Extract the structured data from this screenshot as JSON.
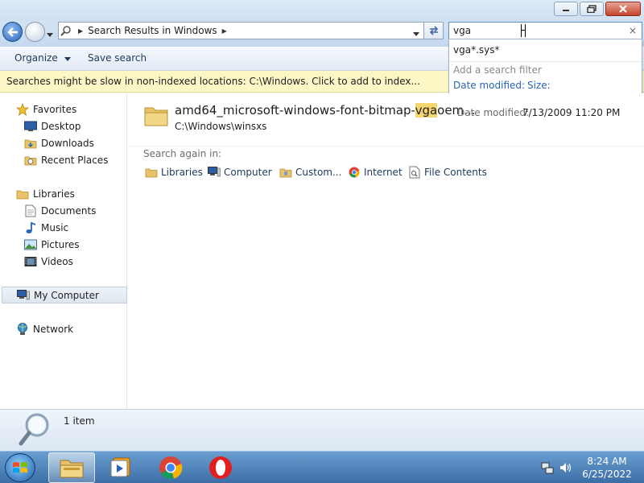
{
  "address": {
    "location": "Search Results in Windows"
  },
  "search": {
    "value": "vga",
    "clear_glyph": "×"
  },
  "suggestions": {
    "items": [
      "vga*.sys*"
    ],
    "filter_title": "Add a search filter",
    "filters": [
      "Date modified:",
      "Size:"
    ]
  },
  "toolbar": {
    "organize": "Organize",
    "save_search": "Save search"
  },
  "infobar": {
    "text": "Searches might be slow in non-indexed locations: C:\\Windows. Click to add to index..."
  },
  "sidebar": {
    "favorites": {
      "label": "Favorites",
      "items": [
        "Desktop",
        "Downloads",
        "Recent Places"
      ]
    },
    "libraries": {
      "label": "Libraries",
      "items": [
        "Documents",
        "Music",
        "Pictures",
        "Videos"
      ]
    },
    "computer": "My Computer",
    "network": "Network"
  },
  "results": [
    {
      "name_before": "amd64_microsoft-windows-font-bitmap-",
      "name_highlight": "vga",
      "name_after": "oem...",
      "path": "C:\\Windows\\winsxs",
      "date_label": "Date modified:",
      "date": "7/13/2009 11:20 PM"
    }
  ],
  "search_again": {
    "label": "Search again in:",
    "items": [
      "Libraries",
      "Computer",
      "Custom...",
      "Internet",
      "File Contents"
    ]
  },
  "details": {
    "count": "1 item"
  },
  "taskbar": {
    "time": "8:24 AM",
    "date": "6/25/2022"
  },
  "colors": {
    "accent": "#2b64b5",
    "highlight": "#f6d66e",
    "infobar": "#fdf7c6",
    "taskbar": "#4a7fb8"
  }
}
